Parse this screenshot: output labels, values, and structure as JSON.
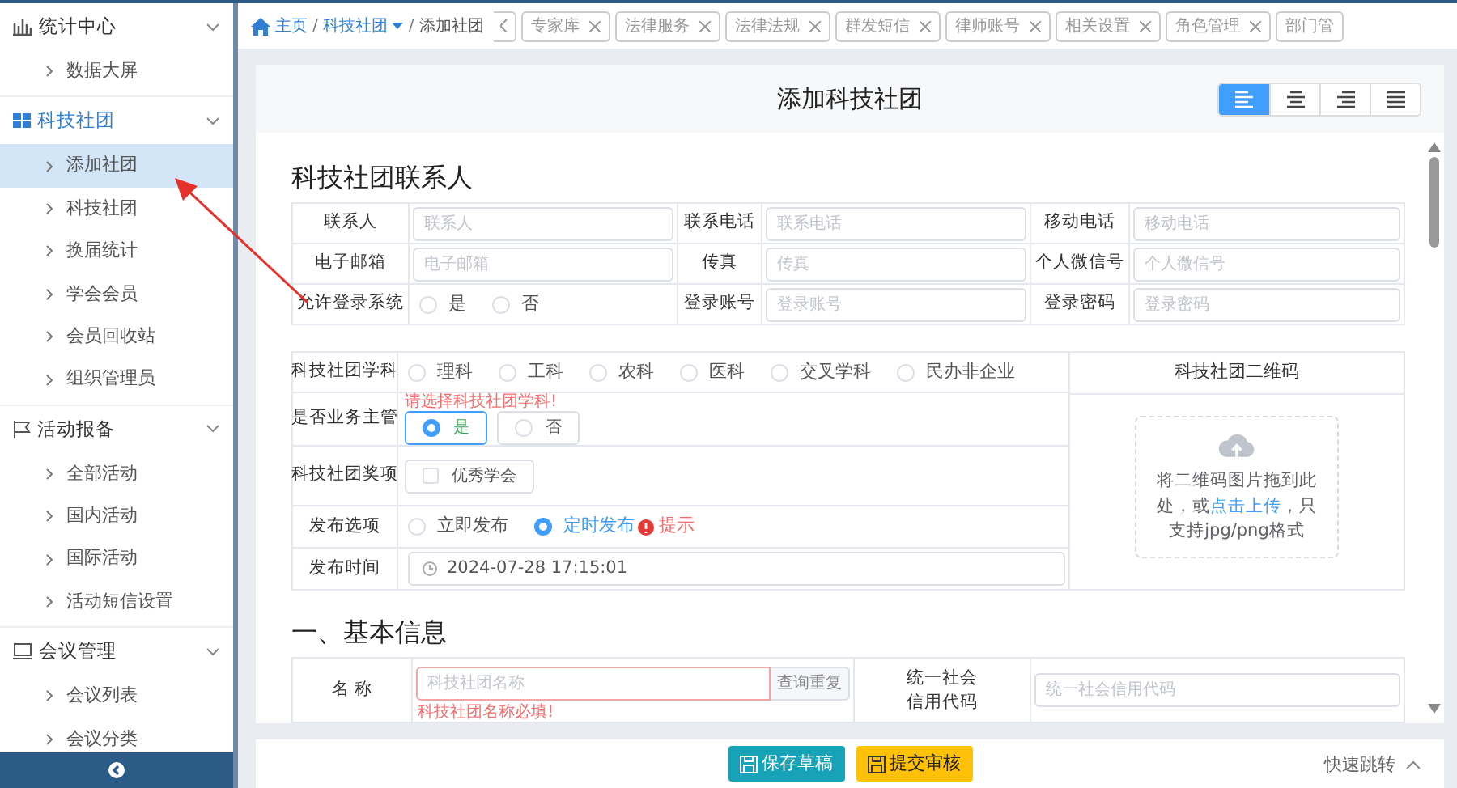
{
  "sidebar": {
    "groups": [
      {
        "label": "统计中心",
        "expanded": true,
        "selected": false,
        "items": [
          {
            "label": "数据大屏",
            "selected": false
          }
        ]
      },
      {
        "label": "科技社团",
        "expanded": true,
        "selected": true,
        "items": [
          {
            "label": "添加社团",
            "selected": true
          },
          {
            "label": "科技社团",
            "selected": false
          },
          {
            "label": "换届统计",
            "selected": false
          },
          {
            "label": "学会会员",
            "selected": false
          },
          {
            "label": "会员回收站",
            "selected": false
          },
          {
            "label": "组织管理员",
            "selected": false
          }
        ]
      },
      {
        "label": "活动报备",
        "expanded": true,
        "selected": false,
        "items": [
          {
            "label": "全部活动",
            "selected": false
          },
          {
            "label": "国内活动",
            "selected": false
          },
          {
            "label": "国际活动",
            "selected": false
          },
          {
            "label": "活动短信设置",
            "selected": false
          }
        ]
      },
      {
        "label": "会议管理",
        "expanded": true,
        "selected": false,
        "items": [
          {
            "label": "会议列表",
            "selected": false
          },
          {
            "label": "会议分类",
            "selected": false
          }
        ]
      }
    ]
  },
  "breadcrumb": [
    {
      "label": "主页",
      "dropdown": false
    },
    {
      "separator": "/",
      "label": "科技社团",
      "dropdown": true
    },
    {
      "separator": "/",
      "label": "添加社团",
      "dropdown": false
    }
  ],
  "tabs": [
    {
      "label": "专家库"
    },
    {
      "label": "法律服务"
    },
    {
      "label": "法律法规"
    },
    {
      "label": "群发短信"
    },
    {
      "label": "律师账号"
    },
    {
      "label": "相关设置"
    },
    {
      "label": "角色管理"
    },
    {
      "label": "部门管"
    }
  ],
  "page_title": "添加科技社团",
  "align_buttons": [
    {
      "selected": true
    },
    {
      "selected": false
    },
    {
      "selected": false
    },
    {
      "selected": false
    }
  ],
  "contact": {
    "title": "科技社团联系人",
    "rows": [
      [
        {
          "label": "联系人",
          "kind": "input",
          "placeholder": "联系人"
        },
        {
          "label": "联系电话",
          "kind": "input",
          "placeholder": "联系电话"
        },
        {
          "label": "移动电话",
          "kind": "input",
          "placeholder": "移动电话"
        }
      ],
      [
        {
          "label": "电子邮箱",
          "kind": "input",
          "placeholder": "电子邮箱"
        },
        {
          "label": "传真",
          "kind": "input",
          "placeholder": "传真"
        },
        {
          "label": "个人微信号",
          "kind": "input",
          "placeholder": "个人微信号"
        }
      ],
      [
        {
          "label": "允许登录系统",
          "kind": "radio",
          "options": [
            {
              "label": "是",
              "selected": false
            },
            {
              "label": "否",
              "selected": false
            }
          ]
        },
        {
          "label": "登录账号",
          "kind": "input",
          "placeholder": "登录账号"
        },
        {
          "label": "登录密码",
          "kind": "input",
          "placeholder": "登录密码"
        }
      ]
    ]
  },
  "details": {
    "rows": [
      {
        "label": "科技社团学科",
        "kind": "radio",
        "options": [
          {
            "label": "理科",
            "selected": false
          },
          {
            "label": "工科",
            "selected": false
          },
          {
            "label": "农科",
            "selected": false
          },
          {
            "label": "医科",
            "selected": false
          },
          {
            "label": "交叉学科",
            "selected": false
          },
          {
            "label": "民办非企业",
            "selected": false
          }
        ]
      },
      {
        "label": "是否业务主管",
        "kind": "radio_box",
        "error": "请选择科技社团学科!",
        "options": [
          {
            "label": "是",
            "selected": true
          },
          {
            "label": "否",
            "selected": false
          }
        ]
      },
      {
        "label": "科技社团奖项",
        "kind": "checkbox_box",
        "options": [
          {
            "label": "优秀学会",
            "checked": false
          }
        ]
      },
      {
        "label": "发布选项",
        "kind": "radio",
        "hint": "提示",
        "options": [
          {
            "label": "立即发布",
            "selected": false
          },
          {
            "label": "定时发布",
            "selected": true
          }
        ]
      },
      {
        "label": "发布时间",
        "kind": "datetime",
        "value": "2024-07-28 17:15:01"
      }
    ],
    "qr": {
      "title": "科技社团二维码",
      "text_before": "将二维码图片拖到此处，或",
      "link": "点击上传",
      "text_after": "，只支持jpg/png格式"
    }
  },
  "basic": {
    "title": "一、基本信息",
    "rows": [
      {
        "label": "名 称",
        "placeholder": "科技社团名称",
        "error": "科技社团名称必填!",
        "button": "查询重复",
        "label2": "统一社会信用代码",
        "placeholder2": "统一社会信用代码"
      }
    ]
  },
  "footer": {
    "buttons": [
      {
        "label": "保存草稿",
        "kind": "info"
      },
      {
        "label": "提交审核",
        "kind": "warning"
      }
    ],
    "quick_jump": "快速跳转"
  }
}
